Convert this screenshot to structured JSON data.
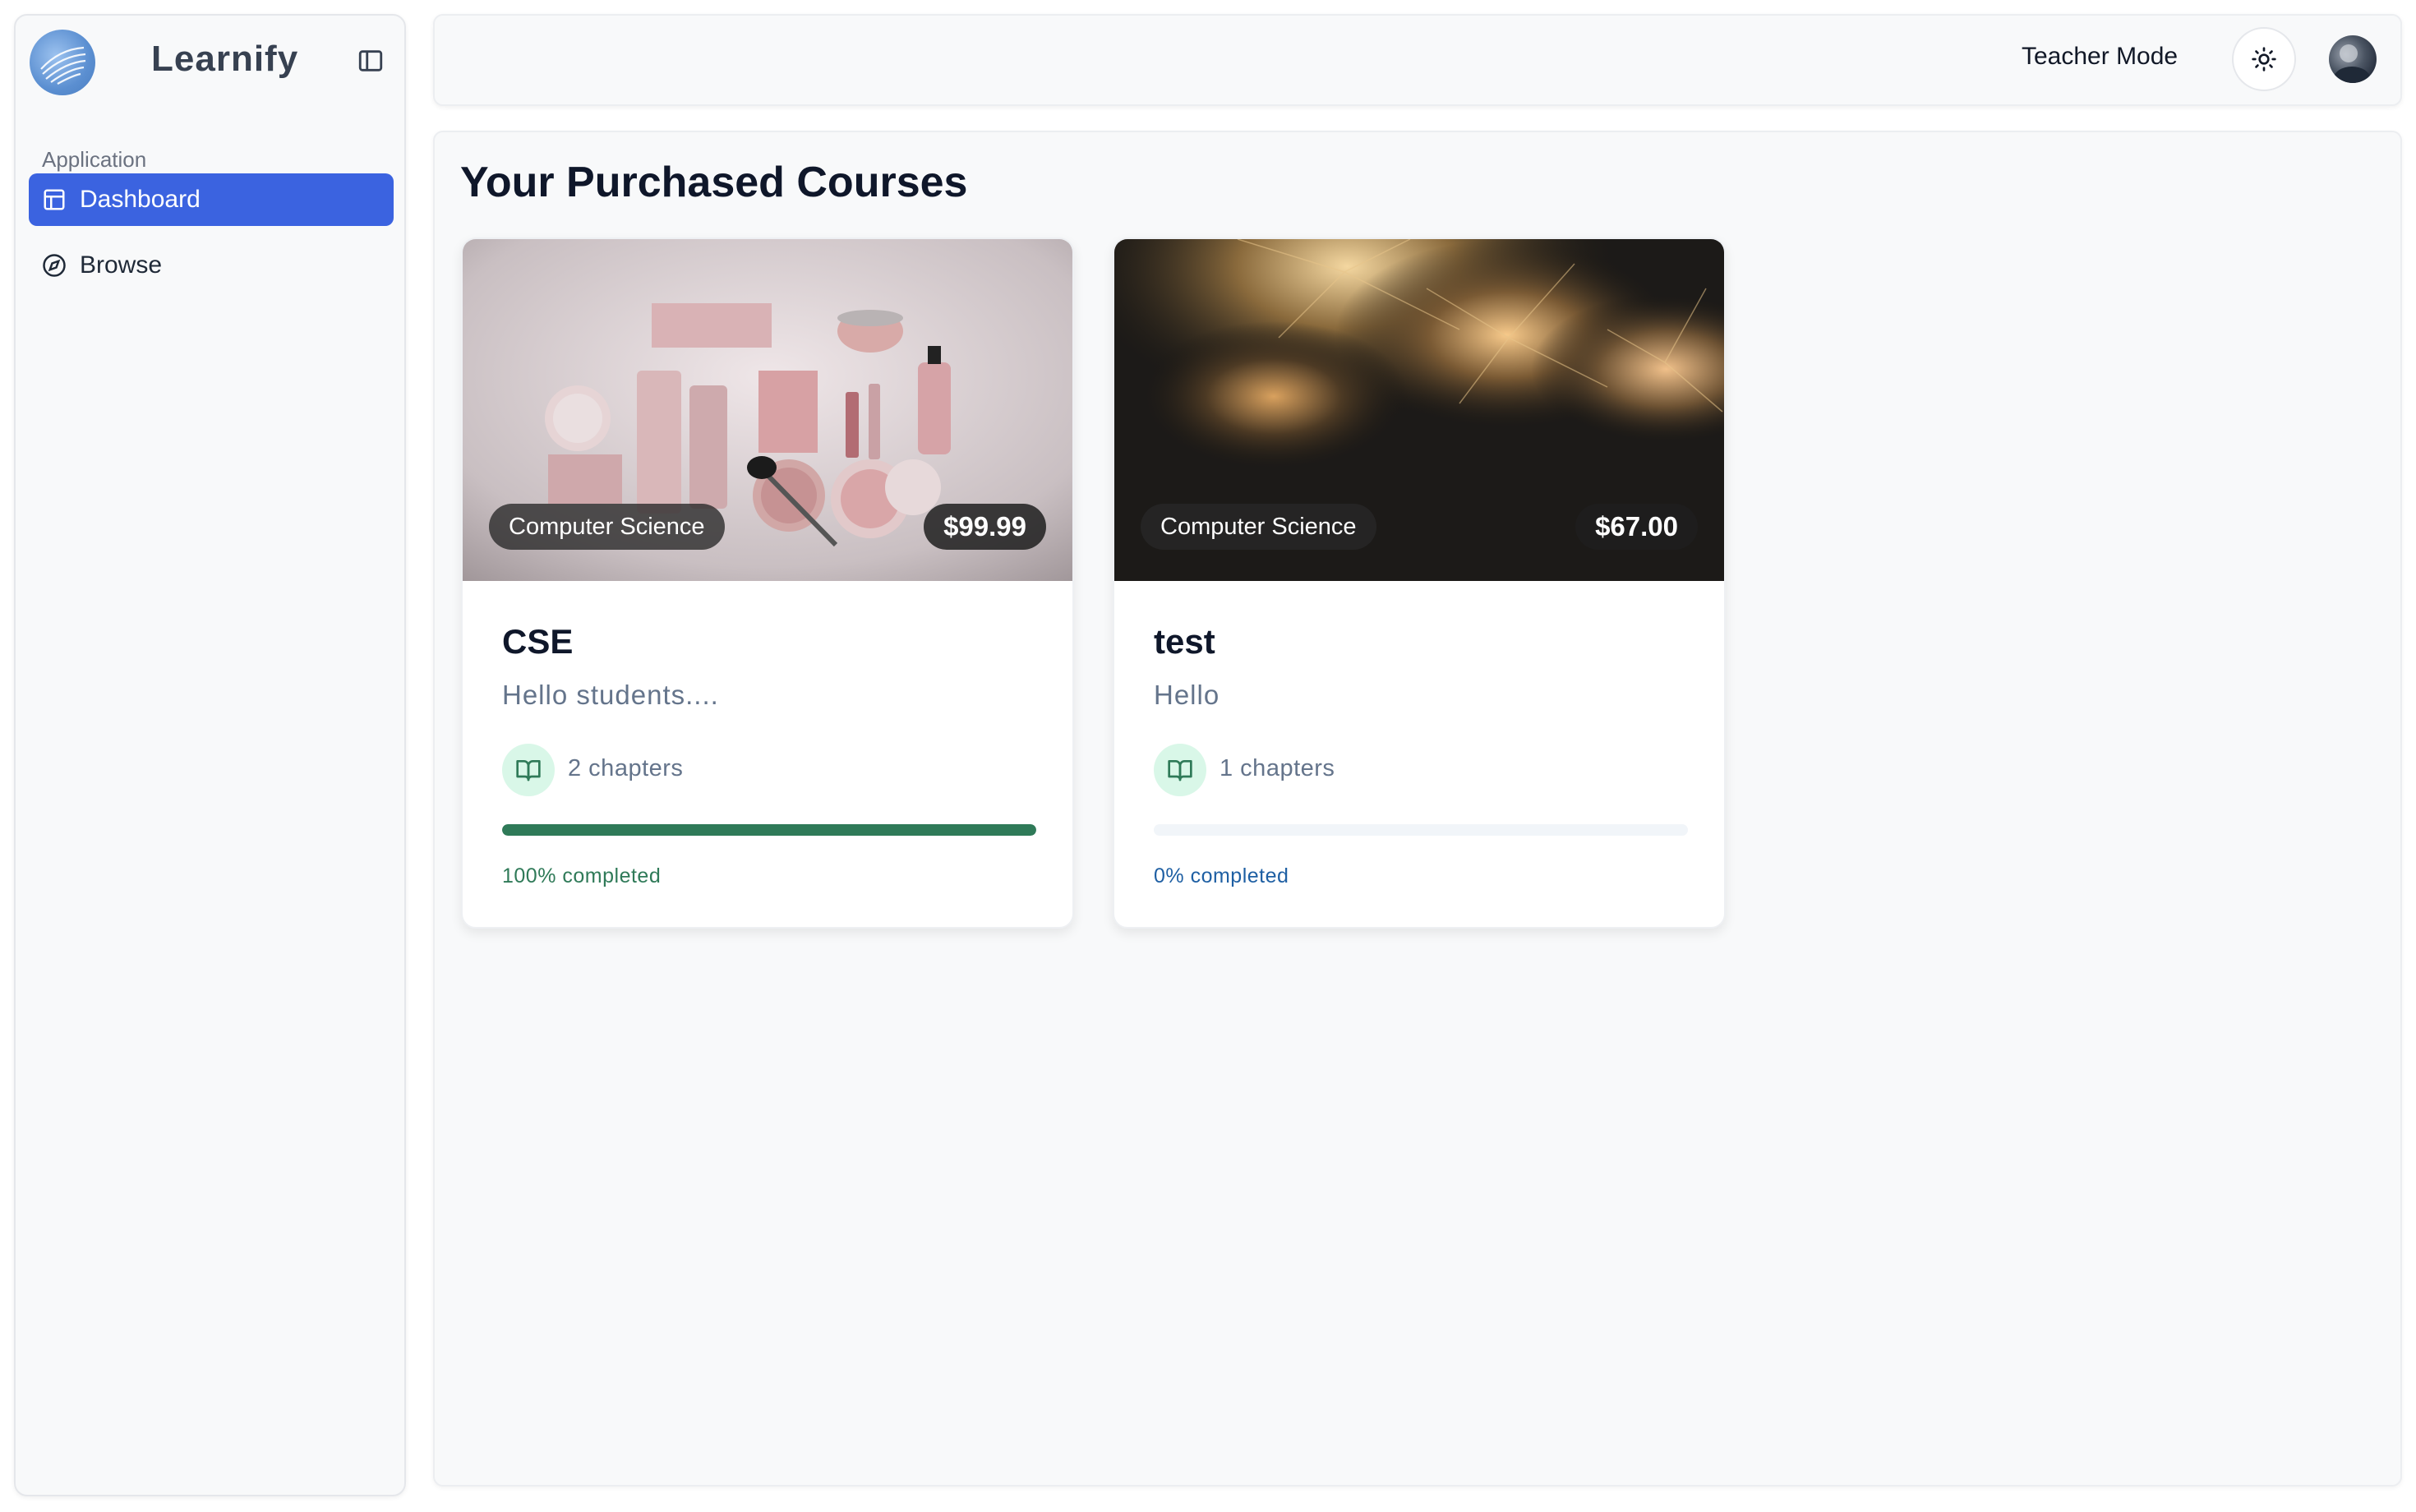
{
  "sidebar": {
    "brand": "Learnify",
    "section_label": "Application",
    "items": [
      {
        "label": "Dashboard",
        "icon": "layout-icon",
        "active": true
      },
      {
        "label": "Browse",
        "icon": "compass-icon",
        "active": false
      }
    ]
  },
  "header": {
    "teacher_mode": "Teacher Mode",
    "theme_icon": "sun-icon"
  },
  "main": {
    "title": "Your Purchased Courses",
    "courses": [
      {
        "category": "Computer Science",
        "price": "$99.99",
        "title": "CSE",
        "description": "Hello students....",
        "chapters": "2 chapters",
        "progress": 100,
        "progress_label": "100% completed",
        "progress_color": "#2f7a58"
      },
      {
        "category": "Computer Science",
        "price": "$67.00",
        "title": "test",
        "description": "Hello",
        "chapters": "1 chapters",
        "progress": 0,
        "progress_label": "0% completed",
        "progress_color": "#1e5fa3"
      }
    ]
  },
  "colors": {
    "accent": "#3b63e0",
    "success": "#2f7a58",
    "chapter_icon_bg": "#d9f7e8"
  }
}
